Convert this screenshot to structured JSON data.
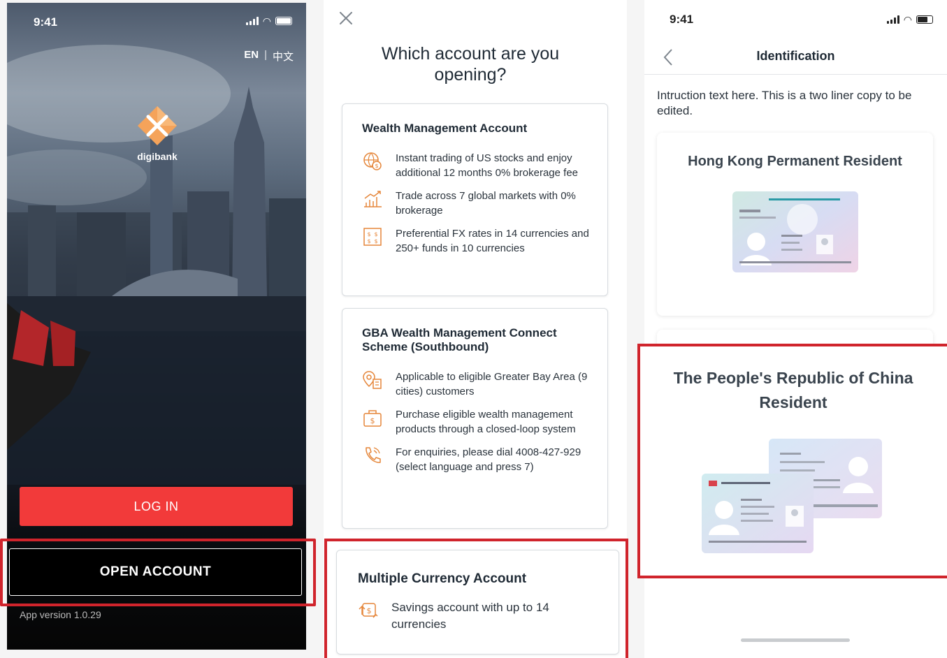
{
  "screen_login": {
    "time": "9:41",
    "lang_en": "EN",
    "lang_separator": "|",
    "lang_zh": "中文",
    "brand_name": "digibank",
    "login_label": "LOG IN",
    "open_account_label": "OPEN ACCOUNT",
    "app_version": "App version 1.0.29",
    "colors": {
      "login_button": "#f23a3a",
      "highlight": "#d0242c",
      "logo": "#f5a35a"
    }
  },
  "screen_account_type": {
    "title": "Which account are you opening?",
    "cards": [
      {
        "title": "Wealth Management Account",
        "features": [
          {
            "icon": "globe-dollar-icon",
            "text": "Instant trading of US stocks and enjoy additional 12 months 0% brokerage fee"
          },
          {
            "icon": "bar-chart-growth-icon",
            "text": "Trade across 7 global markets with 0% brokerage"
          },
          {
            "icon": "fx-currency-icon",
            "text": "Preferential FX rates in 14 currencies and 250+ funds in 10 currencies"
          }
        ]
      },
      {
        "title": "GBA Wealth Management Connect Scheme (Southbound)",
        "features": [
          {
            "icon": "location-building-icon",
            "text": "Applicable to eligible Greater Bay Area (9 cities) customers"
          },
          {
            "icon": "money-bag-icon",
            "text": "Purchase eligible wealth management products through a closed-loop system"
          },
          {
            "icon": "phone-call-icon",
            "text": "For enquiries, please dial 4008-427-929 (select language and press 7)"
          }
        ]
      },
      {
        "title": "Multiple Currency Account",
        "features": [
          {
            "icon": "currency-exchange-icon",
            "text": "Savings account with up to 14 currencies"
          }
        ]
      }
    ]
  },
  "screen_identification": {
    "time": "9:41",
    "title": "Identification",
    "instruction": "Intruction text here. This is a two liner copy to be edited.",
    "options": [
      {
        "label": "Hong Kong Permanent Resident",
        "icon": "hk-id-card-icon"
      },
      {
        "label": "The People's Republic of China Resident",
        "icon": "prc-id-cards-icon"
      }
    ]
  }
}
